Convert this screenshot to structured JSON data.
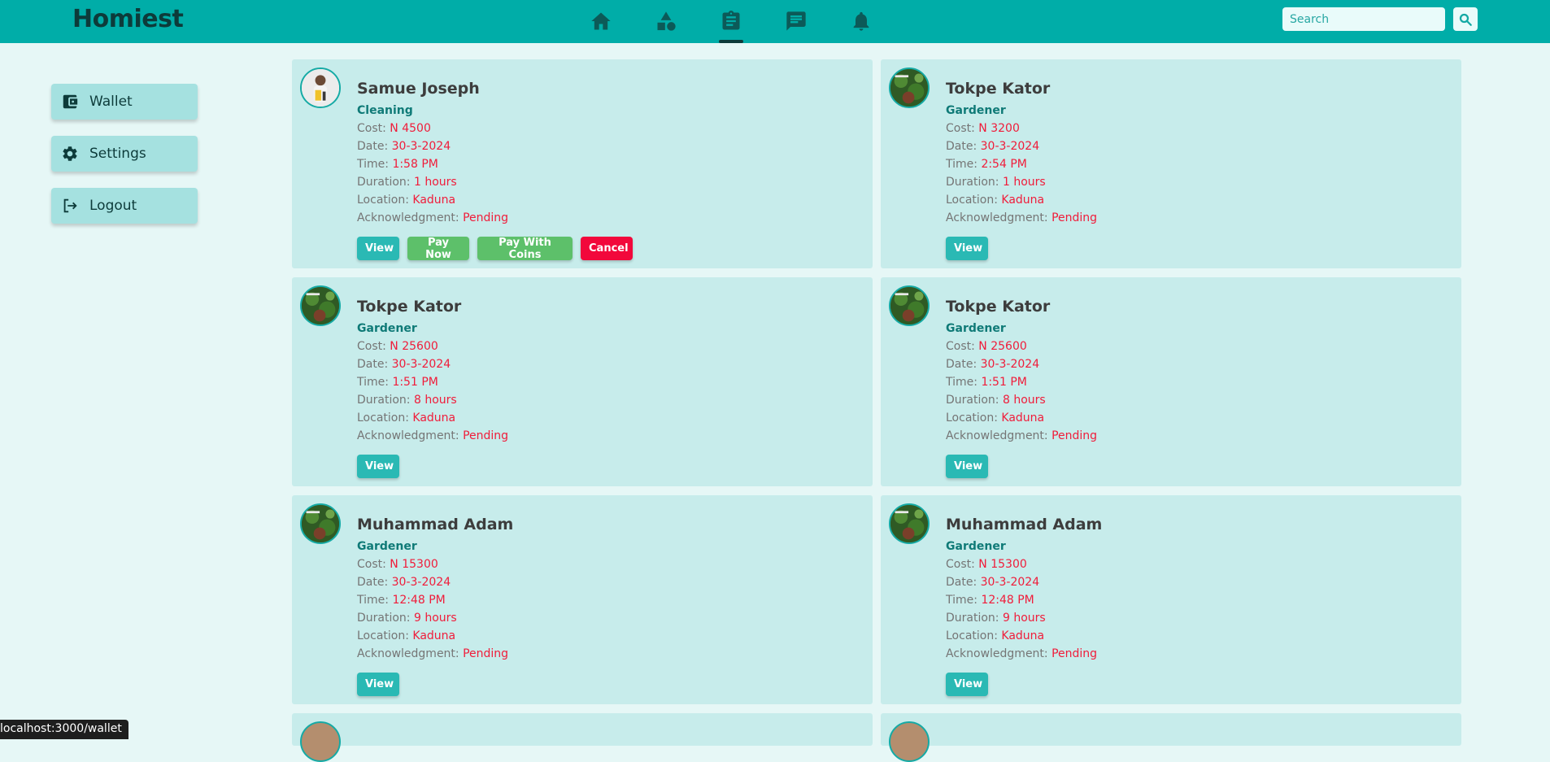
{
  "app": {
    "title": "Homiest"
  },
  "search": {
    "placeholder": "Search"
  },
  "sidebar": {
    "items": [
      {
        "label": "Wallet"
      },
      {
        "label": "Settings"
      },
      {
        "label": "Logout"
      }
    ]
  },
  "labels": {
    "cost": "Cost: ",
    "date": "Date: ",
    "time": "Time: ",
    "duration": "Duration: ",
    "location": "Location: ",
    "ack": "Acknowledgment: "
  },
  "buttons": {
    "view": "View",
    "pay_now": "Pay Now",
    "pay_with_coins": "Pay With Coins",
    "cancel": "Cancel"
  },
  "bookings": [
    {
      "name": "Samue Joseph",
      "category": "Cleaning",
      "cost": "N 4500",
      "date": "30-3-2024",
      "time": "1:58 PM",
      "duration": "1 hours",
      "location": "Kaduna",
      "ack": "Pending"
    },
    {
      "name": "Tokpe Kator",
      "category": "Gardener",
      "cost": "N 3200",
      "date": "30-3-2024",
      "time": "2:54 PM",
      "duration": "1 hours",
      "location": "Kaduna",
      "ack": "Pending"
    },
    {
      "name": "Tokpe Kator",
      "category": "Gardener",
      "cost": "N 25600",
      "date": "30-3-2024",
      "time": "1:51 PM",
      "duration": "8 hours",
      "location": "Kaduna",
      "ack": "Pending"
    },
    {
      "name": "Tokpe Kator",
      "category": "Gardener",
      "cost": "N 25600",
      "date": "30-3-2024",
      "time": "1:51 PM",
      "duration": "8 hours",
      "location": "Kaduna",
      "ack": "Pending"
    },
    {
      "name": "Muhammad Adam",
      "category": "Gardener",
      "cost": "N 15300",
      "date": "30-3-2024",
      "time": "12:48 PM",
      "duration": "9 hours",
      "location": "Kaduna",
      "ack": "Pending"
    },
    {
      "name": "Muhammad Adam",
      "category": "Gardener",
      "cost": "N 15300",
      "date": "30-3-2024",
      "time": "12:48 PM",
      "duration": "9 hours",
      "location": "Kaduna",
      "ack": "Pending"
    }
  ],
  "statusbar": {
    "url": "localhost:3000/wallet"
  },
  "colors": {
    "topbar": "#00ada8",
    "accent": "#2ab9b4",
    "danger": "#f2083b",
    "success": "#5dc06a"
  }
}
